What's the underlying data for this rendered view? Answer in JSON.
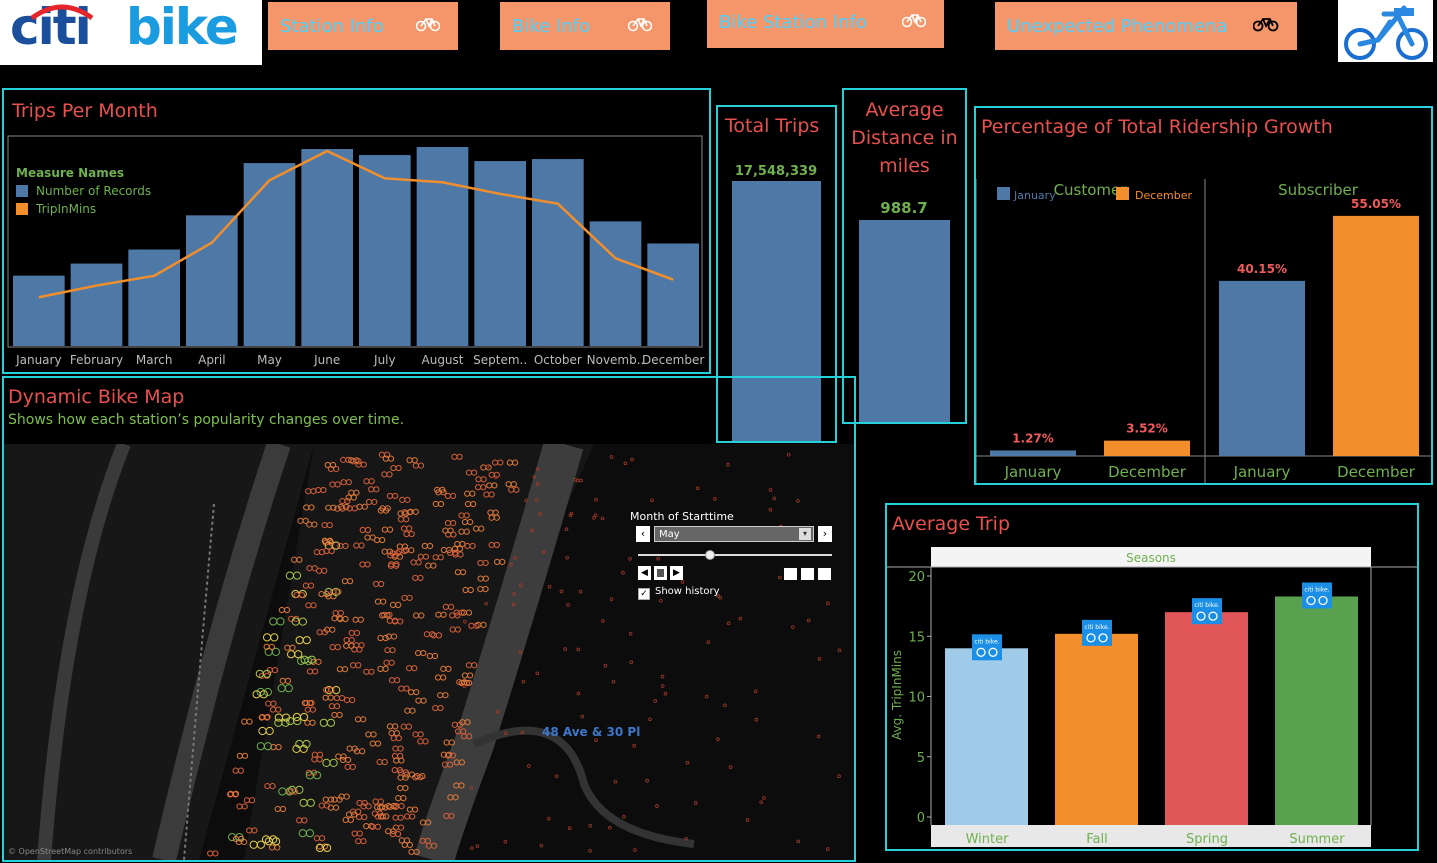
{
  "nav": {
    "logo_a": "citi",
    "logo_b": "bike",
    "items": [
      {
        "label": "Station Info"
      },
      {
        "label": "Bike Info"
      },
      {
        "label": "Bike Station Info"
      },
      {
        "label": "Unexpected Phenomena"
      }
    ]
  },
  "colors": {
    "blue": "#4e79a7",
    "orange": "#f28e2b",
    "green": "#59a14f",
    "red": "#e15759",
    "lightblue": "#a0cbe8",
    "accent": "#26d0d8",
    "title": "#e8504f",
    "label_green": "#6fb04f"
  },
  "trips_per_month": {
    "title": "Trips Per Month",
    "legend_title": "Measure Names",
    "legend": [
      "Number of Records",
      "TripInMins"
    ]
  },
  "total_trips": {
    "title": "Total Trips",
    "value_label": "17,548,339"
  },
  "avg_distance": {
    "title_lines": [
      "Average",
      "Distance in",
      "miles"
    ],
    "value_label": "988.7"
  },
  "growth": {
    "title": "Percentage of Total Ridership Growth",
    "legend": [
      "January",
      "December"
    ],
    "groups": [
      "Customer",
      "Subscriber"
    ]
  },
  "map": {
    "title": "Dynamic Bike Map",
    "subtitle": "Shows how each station’s popularity changes over time.",
    "location_label": "48 Ave & 30 Pl",
    "attribution": "© OpenStreetMap contributors",
    "filter_title": "Month of Starttime",
    "filter_value": "May",
    "show_history": "Show history"
  },
  "avg_trip": {
    "title": "Average Trip",
    "header": "Seasons",
    "ylabel": "Avg. TripInMins",
    "badge": "citi bike."
  },
  "chart_data": [
    {
      "type": "bar",
      "title": "Trips Per Month",
      "categories": [
        "January",
        "February",
        "March",
        "April",
        "May",
        "June",
        "July",
        "August",
        "Septem..",
        "October",
        "Novemb..",
        "December"
      ],
      "series": [
        {
          "name": "Number of Records",
          "type": "bar",
          "values": [
            0.35,
            0.41,
            0.48,
            0.65,
            0.91,
            0.98,
            0.95,
            0.99,
            0.92,
            0.93,
            0.62,
            0.51
          ]
        },
        {
          "name": "TripInMins",
          "type": "line",
          "values": [
            0.25,
            0.31,
            0.36,
            0.53,
            0.85,
            1.0,
            0.86,
            0.84,
            0.78,
            0.73,
            0.45,
            0.34
          ]
        }
      ]
    },
    {
      "type": "bar",
      "title": "Total Trips",
      "categories": [
        ""
      ],
      "values": [
        17548339
      ]
    },
    {
      "type": "bar",
      "title": "Average Distance in miles",
      "categories": [
        ""
      ],
      "values": [
        988.7
      ]
    },
    {
      "type": "bar",
      "title": "Percentage of Total Ridership Growth",
      "groups": [
        "Customer",
        "Subscriber"
      ],
      "categories": [
        "January",
        "December"
      ],
      "series": [
        {
          "group": "Customer",
          "values": [
            1.27,
            3.52
          ],
          "labels": [
            "1.27%",
            "3.52%"
          ]
        },
        {
          "group": "Subscriber",
          "values": [
            40.15,
            55.05
          ],
          "labels": [
            "40.15%",
            "55.05%"
          ]
        }
      ]
    },
    {
      "type": "bar",
      "title": "Average Trip",
      "xlabel": "Seasons",
      "ylabel": "Avg. TripInMins",
      "categories": [
        "Winter",
        "Fall",
        "Spring",
        "Summer"
      ],
      "values": [
        14.0,
        15.2,
        17.0,
        18.3
      ],
      "ylim": [
        0,
        20
      ],
      "yticks": [
        0,
        5,
        10,
        15,
        20
      ]
    }
  ]
}
